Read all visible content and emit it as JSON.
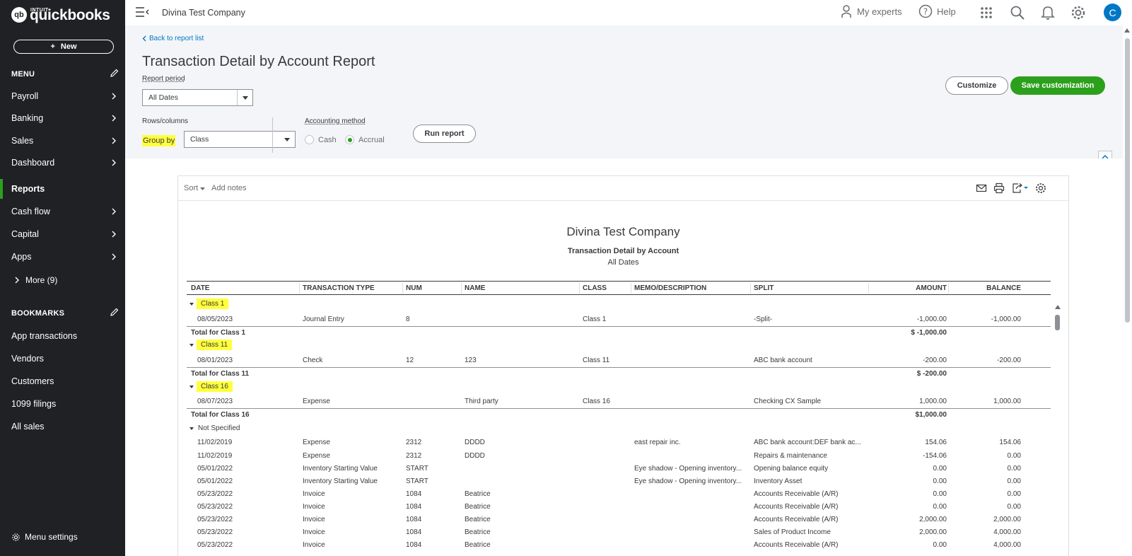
{
  "brand": {
    "intuit": "INTUIT",
    "name": "quickbooks",
    "mark": "qb"
  },
  "sidebar": {
    "new_label": "New",
    "menu_heading": "MENU",
    "items": [
      "Payroll",
      "Banking",
      "Sales",
      "Dashboard",
      "Reports",
      "Cash flow",
      "Capital",
      "Apps"
    ],
    "active": "Reports",
    "more": "More (9)",
    "bookmarks_heading": "BOOKMARKS",
    "bookmarks": [
      "App transactions",
      "Vendors",
      "Customers",
      "1099 filings",
      "All sales"
    ],
    "menu_settings": "Menu settings"
  },
  "topbar": {
    "company": "Divina Test Company",
    "my_experts": "My experts",
    "help": "Help",
    "avatar": "C"
  },
  "header": {
    "back": "Back to report list",
    "title": "Transaction Detail by Account Report",
    "report_period_label": "Report period",
    "report_period_value": "All Dates",
    "rows_columns_label": "Rows/columns",
    "group_by_label": "Group by",
    "group_by_value": "Class",
    "accounting_method_label": "Accounting method",
    "cash": "Cash",
    "accrual": "Accrual",
    "selected_method": "Accrual",
    "run_report": "Run report",
    "customize": "Customize",
    "save_customization": "Save customization"
  },
  "report": {
    "sort": "Sort",
    "add_notes": "Add notes",
    "company": "Divina Test Company",
    "title": "Transaction Detail by Account",
    "dates": "All Dates",
    "columns": [
      "DATE",
      "TRANSACTION TYPE",
      "NUM",
      "NAME",
      "CLASS",
      "MEMO/DESCRIPTION",
      "SPLIT",
      "AMOUNT",
      "BALANCE"
    ],
    "groups": [
      {
        "name": "Class 1",
        "rows": [
          [
            "08/05/2023",
            "Journal Entry",
            "8",
            "",
            "Class 1",
            "",
            "-Split-",
            "-1,000.00",
            "-1,000.00"
          ]
        ],
        "total_label": "Total for Class 1",
        "total": "$ -1,000.00"
      },
      {
        "name": "Class 11",
        "rows": [
          [
            "08/01/2023",
            "Check",
            "12",
            "123",
            "Class 11",
            "",
            "ABC bank account",
            "-200.00",
            "-200.00"
          ]
        ],
        "total_label": "Total for Class 11",
        "total": "$ -200.00"
      },
      {
        "name": "Class 16",
        "rows": [
          [
            "08/07/2023",
            "Expense",
            "",
            "Third party",
            "Class 16",
            "",
            "Checking CX Sample",
            "1,000.00",
            "1,000.00"
          ]
        ],
        "total_label": "Total for Class 16",
        "total": "$1,000.00"
      }
    ],
    "not_specified": {
      "name": "Not Specified",
      "rows": [
        [
          "11/02/2019",
          "Expense",
          "2312",
          "DDDD",
          "",
          "east repair inc.",
          "ABC bank account:DEF bank ac...",
          "154.06",
          "154.06"
        ],
        [
          "11/02/2019",
          "Expense",
          "2312",
          "DDDD",
          "",
          "",
          "Repairs & maintenance",
          "-154.06",
          "0.00"
        ],
        [
          "05/01/2022",
          "Inventory Starting Value",
          "START",
          "",
          "",
          "Eye shadow - Opening inventory...",
          "Opening balance equity",
          "0.00",
          "0.00"
        ],
        [
          "05/01/2022",
          "Inventory Starting Value",
          "START",
          "",
          "",
          "Eye shadow - Opening inventory...",
          "Inventory Asset",
          "0.00",
          "0.00"
        ],
        [
          "05/23/2022",
          "Invoice",
          "1084",
          "Beatrice",
          "",
          "",
          "Accounts Receivable (A/R)",
          "0.00",
          "0.00"
        ],
        [
          "05/23/2022",
          "Invoice",
          "1084",
          "Beatrice",
          "",
          "",
          "Accounts Receivable (A/R)",
          "0.00",
          "0.00"
        ],
        [
          "05/23/2022",
          "Invoice",
          "1084",
          "Beatrice",
          "",
          "",
          "Accounts Receivable (A/R)",
          "2,000.00",
          "2,000.00"
        ],
        [
          "05/23/2022",
          "Invoice",
          "1084",
          "Beatrice",
          "",
          "",
          "Sales of Product Income",
          "2,000.00",
          "4,000.00"
        ],
        [
          "05/23/2022",
          "Invoice",
          "1084",
          "Beatrice",
          "",
          "",
          "Accounts Receivable (A/R)",
          "0.00",
          "4,000.00"
        ]
      ]
    }
  },
  "colors": {
    "accent_green": "#2ca01c",
    "highlight": "#ffff3d",
    "sidebar_bg": "#202124",
    "link_blue": "#0077c5"
  }
}
